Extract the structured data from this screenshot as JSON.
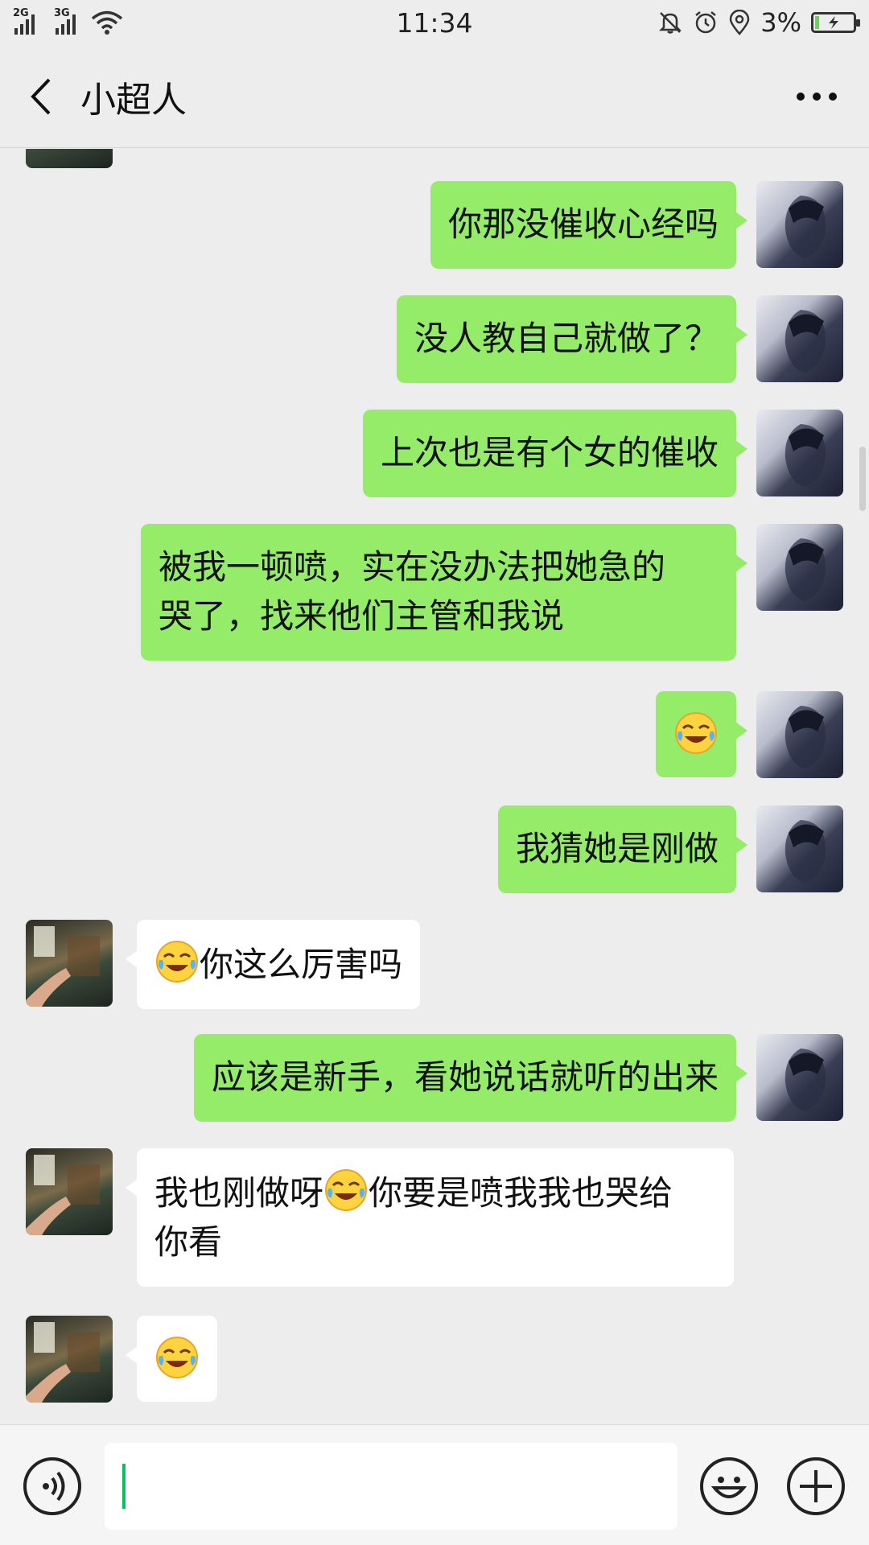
{
  "status_bar": {
    "network_1": "2G",
    "network_2": "3G",
    "time": "11:34",
    "battery": "3%",
    "icons": [
      "mute-bell-icon",
      "alarm-icon",
      "location-icon",
      "battery-charging-icon"
    ]
  },
  "header": {
    "title": "小超人",
    "back_icon": "chevron-left-icon",
    "more_icon": "more-dots-icon"
  },
  "messages": [
    {
      "from": "me",
      "text": "你那没催收心经吗"
    },
    {
      "from": "me",
      "text": "没人教自己就做了？"
    },
    {
      "from": "me",
      "text": "上次也是有个女的催收"
    },
    {
      "from": "me",
      "text_line1": "被我一顿喷，实在没办法把她急的",
      "text_line2": "哭了，找来他们主管和我说"
    },
    {
      "from": "me",
      "emoji": "crying-laughing-emoji"
    },
    {
      "from": "me",
      "text": "我猜她是刚做"
    },
    {
      "from": "them",
      "emoji": "crying-laughing-emoji",
      "text": "你这么厉害吗"
    },
    {
      "from": "me",
      "text": "应该是新手，看她说话就听的出来"
    },
    {
      "from": "them",
      "text_before": "我也刚做呀",
      "emoji": "crying-laughing-emoji",
      "text_after": "你要是喷我我也哭给",
      "text_line2": "你看"
    },
    {
      "from": "them",
      "emoji": "crying-laughing-emoji"
    }
  ],
  "input_bar": {
    "voice_icon": "voice-icon",
    "input_value": "",
    "emoji_icon": "smiley-icon",
    "add_icon": "plus-icon"
  },
  "colors": {
    "my_bubble": "#95ec69",
    "their_bubble": "#ffffff",
    "background": "#ededed",
    "caret": "#07c160"
  }
}
